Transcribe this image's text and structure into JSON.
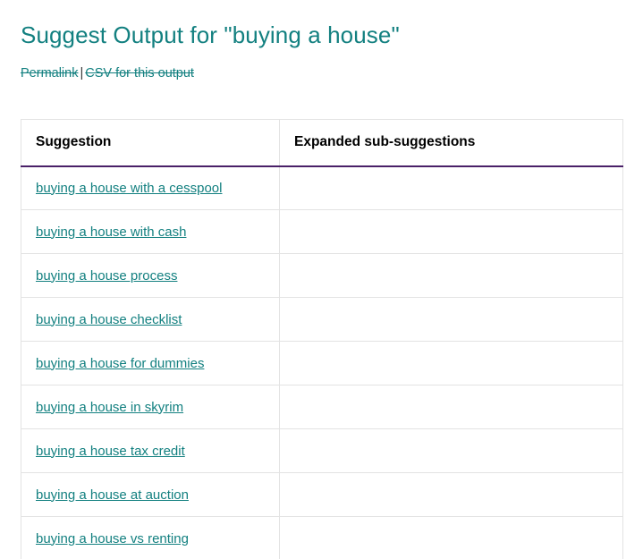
{
  "page": {
    "title": "Suggest Output for \"buying a house\"",
    "title_color": "#138080"
  },
  "meta": {
    "permalink_label": "Permalink",
    "separator": "|",
    "csv_label": "CSV for this output"
  },
  "table": {
    "header_border_color": "#4a2068",
    "columns": [
      {
        "label": "Suggestion"
      },
      {
        "label": "Expanded sub-suggestions"
      }
    ],
    "rows": [
      {
        "suggestion": "buying a house with a cesspool",
        "expanded": ""
      },
      {
        "suggestion": "buying a house with cash",
        "expanded": ""
      },
      {
        "suggestion": "buying a house process",
        "expanded": ""
      },
      {
        "suggestion": "buying a house checklist",
        "expanded": ""
      },
      {
        "suggestion": "buying a house for dummies",
        "expanded": ""
      },
      {
        "suggestion": "buying a house in skyrim",
        "expanded": ""
      },
      {
        "suggestion": "buying a house tax credit",
        "expanded": ""
      },
      {
        "suggestion": "buying a house at auction",
        "expanded": ""
      },
      {
        "suggestion": "buying a house vs renting",
        "expanded": ""
      }
    ]
  }
}
